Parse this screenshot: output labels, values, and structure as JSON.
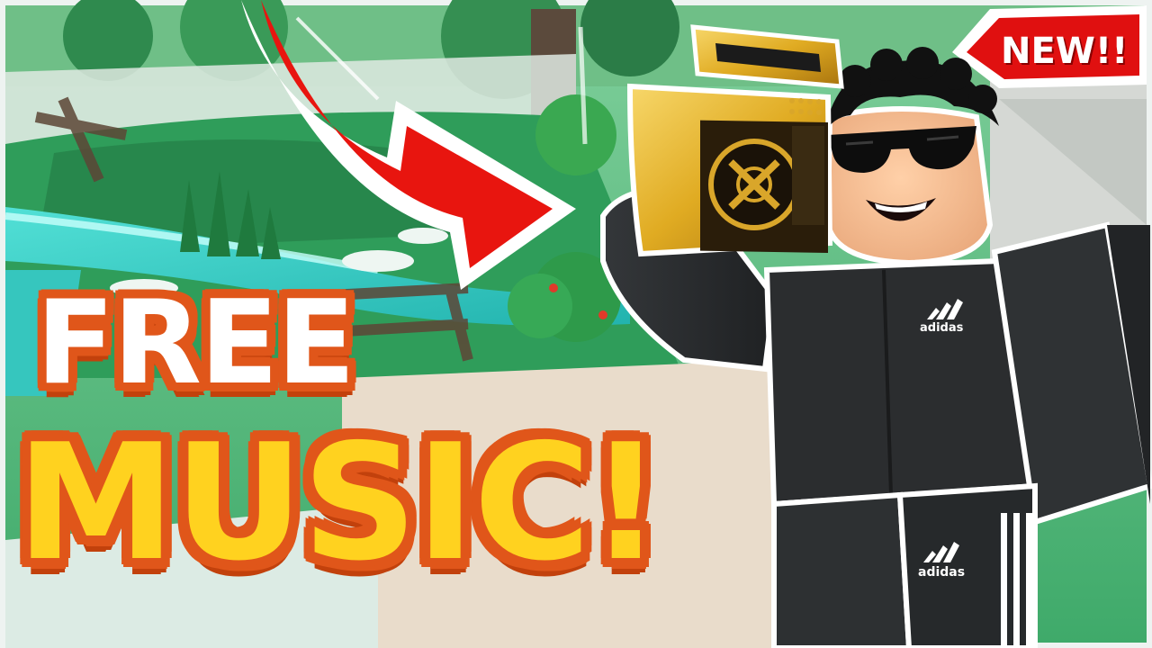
{
  "thumbnail": {
    "headline_line1": "FREE",
    "headline_line2": "MUSIC!",
    "badge": "NEW!!",
    "shirt_logo_top": "adidas",
    "pants_logo": "adidas"
  },
  "colors": {
    "headline_white": "#ffffff",
    "headline_yellow": "#ffd21f",
    "headline_outline": "#e0561a",
    "arrow_red": "#e8150f",
    "badge_red": "#e01010",
    "boombox_gold": "#e3b32b",
    "outfit_black": "#2b2d2f",
    "grass": "#27a35a",
    "water": "#2fc7c0"
  },
  "icons": [
    "curved-arrow-icon",
    "boombox-icon",
    "sunglasses-icon",
    "adidas-logo-icon"
  ]
}
